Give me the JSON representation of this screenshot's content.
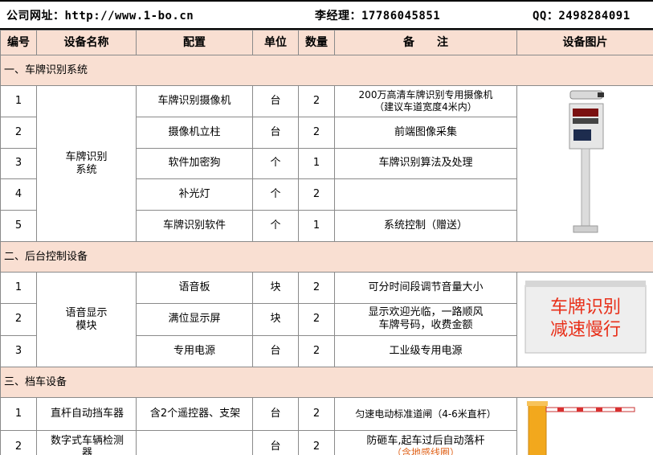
{
  "header": {
    "website": "公司网址：http://www.1-bo.cn",
    "manager": "李经理：17786045851",
    "qq": "QQ：2498284091"
  },
  "columns": [
    "编号",
    "设备名称",
    "配置",
    "单位",
    "数量",
    "备　　注",
    "设备图片"
  ],
  "sections": [
    {
      "title": "一、车牌识别系统",
      "group_name": "车牌识别\n系统",
      "rows": [
        {
          "no": "1",
          "config": "车牌识别摄像机",
          "unit": "台",
          "qty": "2",
          "note": "200万高清车牌识别专用摄像机\n（建议车道宽度4米内）"
        },
        {
          "no": "2",
          "config": "摄像机立柱",
          "unit": "台",
          "qty": "2",
          "note": "前端图像采集"
        },
        {
          "no": "3",
          "config": "软件加密狗",
          "unit": "个",
          "qty": "1",
          "note": "车牌识别算法及处理"
        },
        {
          "no": "4",
          "config": "补光灯",
          "unit": "个",
          "qty": "2",
          "note": ""
        },
        {
          "no": "5",
          "config": "车牌识别软件",
          "unit": "个",
          "qty": "1",
          "note": "系统控制（赠送）"
        }
      ],
      "image": "camera-pole-image"
    },
    {
      "title": "二、后台控制设备",
      "group_name": "语音显示\n模块",
      "rows": [
        {
          "no": "1",
          "config": "语音板",
          "unit": "块",
          "qty": "2",
          "note": "可分时间段调节音量大小"
        },
        {
          "no": "2",
          "config": "满位显示屏",
          "unit": "块",
          "qty": "2",
          "note": "显示欢迎光临，一路顺风\n车牌号码，收费金额"
        },
        {
          "no": "3",
          "config": "专用电源",
          "unit": "台",
          "qty": "2",
          "note": "工业级专用电源"
        }
      ],
      "image": "led-display-image",
      "led_line1": "车牌识别",
      "led_line2": "减速慢行"
    },
    {
      "title": "三、档车设备",
      "rows": [
        {
          "no": "1",
          "name": "直杆自动挡车器",
          "config": "含2个遥控器、支架",
          "unit": "台",
          "qty": "2",
          "note": "匀速电动标准道闸（4-6米直杆）"
        },
        {
          "no": "2",
          "name": "数字式车辆检测\n器",
          "config": "",
          "unit": "台",
          "qty": "2",
          "note": "防砸车,起车过后自动落杆",
          "note_extra": "（含地感线圈）"
        }
      ],
      "image": "barrier-gate-image"
    }
  ],
  "colors": {
    "section_bg": "#f9dfd2",
    "header_bg": "#f9dfd2",
    "led_red": "#e8301a",
    "gate_orange": "#f2a81d"
  }
}
